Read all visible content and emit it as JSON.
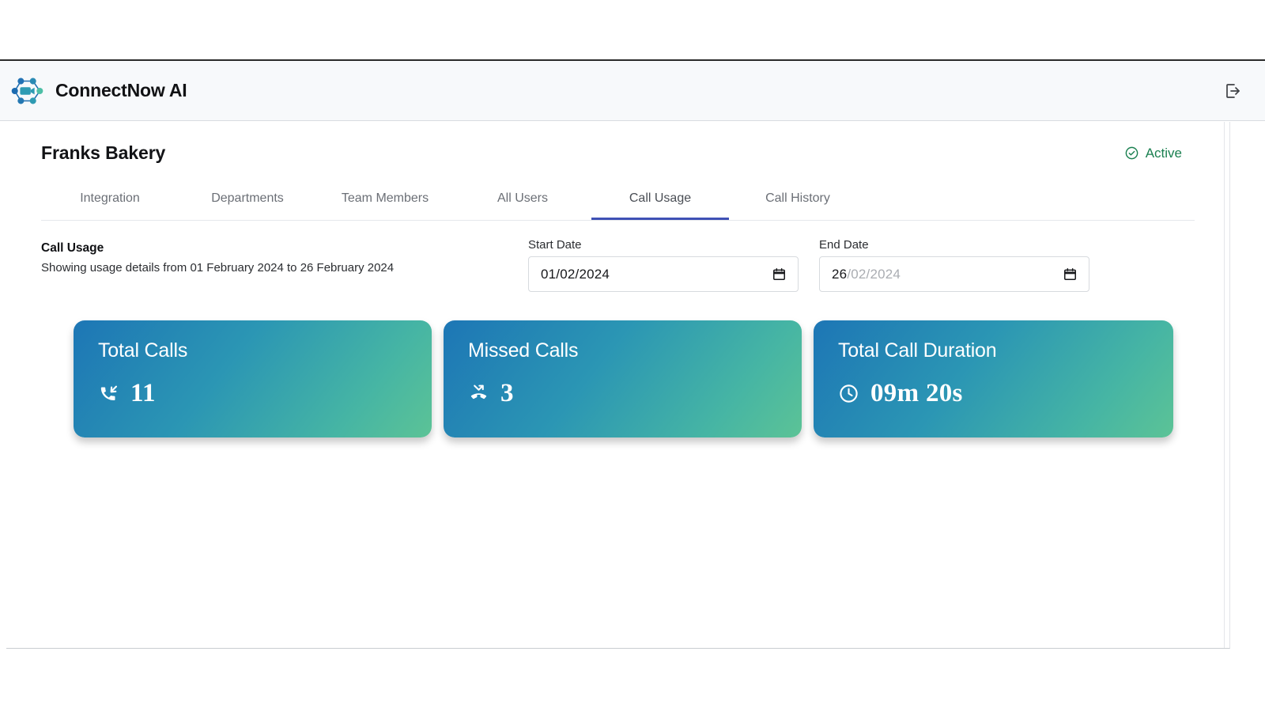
{
  "topbar": {
    "brand_name": "ConnectNow AI",
    "logo_icon": "network-video-logo-icon",
    "logout_icon": "logout-icon"
  },
  "page": {
    "title": "Franks Bakery",
    "status": {
      "label": "Active",
      "icon": "check-circle-icon",
      "color": "#1a8050"
    }
  },
  "tabs": [
    {
      "label": "Integration",
      "active": false
    },
    {
      "label": "Departments",
      "active": false
    },
    {
      "label": "Team Members",
      "active": false
    },
    {
      "label": "All Users",
      "active": false
    },
    {
      "label": "Call Usage",
      "active": true
    },
    {
      "label": "Call History",
      "active": false
    }
  ],
  "usage": {
    "heading": "Call Usage",
    "subheading": "Showing usage details from 01 February 2024 to 26 February 2024",
    "start_date": {
      "label": "Start Date",
      "value": "01/02/2024",
      "placeholder": "dd/mm/yyyy",
      "icon": "calendar-icon"
    },
    "end_date": {
      "label": "End Date",
      "value_filled": "26",
      "value_remaining": "/02/2024",
      "placeholder": "dd/mm/yyyy",
      "icon": "calendar-icon"
    }
  },
  "stats": [
    {
      "label": "Total Calls",
      "value": "11",
      "icon": "phone-incoming-icon"
    },
    {
      "label": "Missed Calls",
      "value": "3",
      "icon": "phone-missed-icon"
    },
    {
      "label": "Total Call Duration",
      "value": "09m 20s",
      "icon": "clock-icon"
    }
  ],
  "theme": {
    "accent": "#3f51b5",
    "card_gradient_start": "#1d76b5",
    "card_gradient_end": "#5cc396",
    "status_green": "#1a8050"
  }
}
